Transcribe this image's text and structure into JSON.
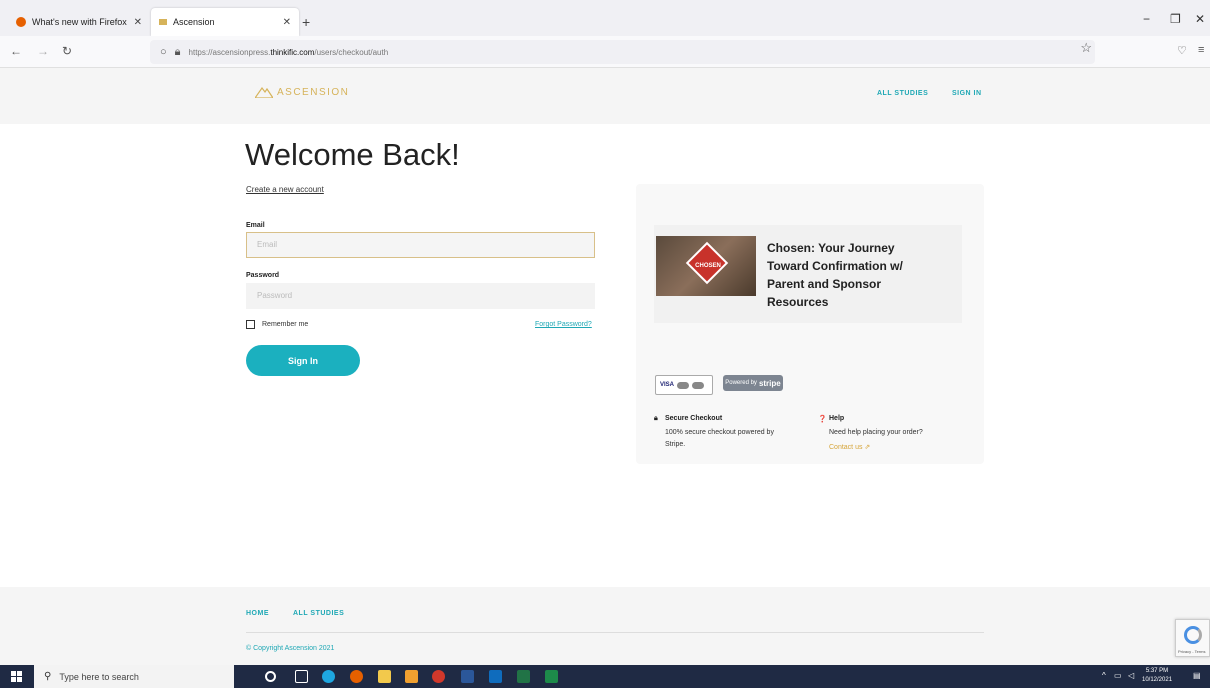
{
  "browser": {
    "tabs": [
      {
        "label": "What's new with Firefox",
        "active": false
      },
      {
        "label": "Ascension",
        "active": true
      }
    ],
    "url_prefix": "https://ascensionpress.",
    "url_domain": "thinkific.com",
    "url_path": "/users/checkout/auth",
    "new_tab_glyph": "+",
    "minimize_glyph": "−",
    "restore_glyph": "❐",
    "close_glyph": "✕"
  },
  "site": {
    "logo_text": "ASCENSION",
    "nav": [
      "ALL STUDIES",
      "SIGN IN"
    ]
  },
  "login": {
    "title": "Welcome Back!",
    "create_account": "Create a new account",
    "email_label": "Email",
    "email_placeholder": "Email",
    "password_label": "Password",
    "password_placeholder": "Password",
    "remember_me": "Remember me",
    "forgot_password": "Forgot Password?",
    "sign_in": "Sign In"
  },
  "product": {
    "title": "Chosen: Your Journey Toward Confirmation w/ Parent and Sponsor Resources",
    "thumb_text": "CHOSEN"
  },
  "payment": {
    "cards_text": "VISA",
    "stripe_prefix": "Powered by",
    "stripe_brand": "stripe",
    "secure_title": "Secure Checkout",
    "secure_text": "100% secure checkout powered by Stripe.",
    "help_title": "Help",
    "help_text": "Need help placing your order?",
    "contact": "Contact us"
  },
  "footer": {
    "links": [
      "HOME",
      "ALL STUDIES"
    ],
    "copyright": "© Copyright Ascension 2021"
  },
  "recaptcha": {
    "text": "Privacy - Terms"
  },
  "taskbar": {
    "search_placeholder": "Type here to search",
    "time": "5:37 PM",
    "date": "10/12/2021"
  },
  "colors": {
    "accent": "#1bb0bf",
    "gold": "#d6b35a",
    "taskbar": "#1f2a44"
  }
}
